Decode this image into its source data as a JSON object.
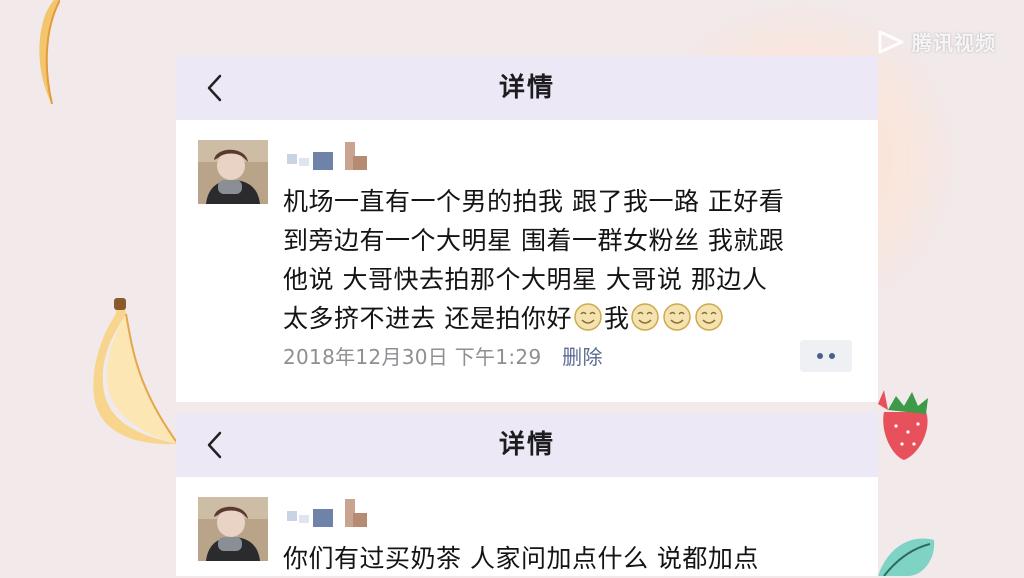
{
  "watermark": {
    "text": "腾讯视频"
  },
  "colors": {
    "header_bg": "#ece8f6",
    "link": "#5a6b94",
    "meta": "#8e8e93",
    "page_bg": "#f1e9ea"
  },
  "panels": [
    {
      "header": {
        "title": "详情",
        "back_icon": "chevron-left-icon"
      },
      "post": {
        "lines": [
          "机场一直有一个男的拍我 跟了我一路 正好看",
          "到旁边有一个大明星 围着一群女粉丝 我就跟",
          "他说 大哥快去拍那个大明星 大哥说 那边人"
        ],
        "line4_prefix": "太多挤不进去 还是拍你好",
        "line4_middle": "我",
        "timestamp": "2018年12月30日 下午1:29",
        "delete_label": "删除"
      }
    },
    {
      "header": {
        "title": "详情",
        "back_icon": "chevron-left-icon"
      },
      "post": {
        "lines": [
          "你们有过买奶茶 人家问加点什么 说都加点"
        ]
      }
    }
  ]
}
